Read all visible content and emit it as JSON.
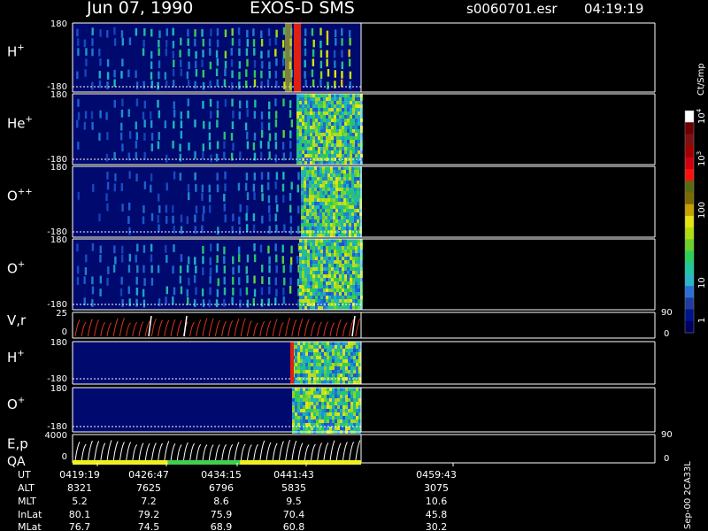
{
  "header": {
    "date": "Jun 07, 1990",
    "instrument": "EXOS-D SMS",
    "file": "s0060701.esr",
    "time": "04:19:19"
  },
  "colorbar": {
    "unit": "Ct/Smp",
    "tick_labels": [
      "1",
      "10",
      "100",
      "10",
      "10"
    ],
    "exponents": [
      "3",
      "4"
    ],
    "colors": [
      "#000060",
      "#00148c",
      "#1f3ca0",
      "#2c6ed8",
      "#29b7c8",
      "#20c8a0",
      "#2bd05a",
      "#6cd02a",
      "#b0dc10",
      "#e4e410",
      "#c8a000",
      "#7a6a00",
      "#5a6a10",
      "#ff1010",
      "#d00010",
      "#a00000",
      "#801010",
      "#6a0000",
      "#ffffff"
    ]
  },
  "panels": [
    {
      "id": "h-plus",
      "label": "H",
      "sup": "+",
      "ymax": "180",
      "ymin": "-180"
    },
    {
      "id": "he-plus",
      "label": "He",
      "sup": "+",
      "ymax": "180",
      "ymin": "-180"
    },
    {
      "id": "o-plusplus",
      "label": "O",
      "sup": "++",
      "ymax": "180",
      "ymin": "-180"
    },
    {
      "id": "o-plus",
      "label": "O",
      "sup": "+",
      "ymax": "180",
      "ymin": "-180"
    },
    {
      "id": "vr",
      "label": "V,r",
      "sup": "",
      "ymax": "25",
      "ymin": "0",
      "r_max": "90",
      "r_min": "0"
    },
    {
      "id": "h-plus-2",
      "label": "H",
      "sup": "+",
      "ymax": "180",
      "ymin": "-180"
    },
    {
      "id": "o-plus-2",
      "label": "O",
      "sup": "+",
      "ymax": "180",
      "ymin": "-180"
    },
    {
      "id": "ep-qa",
      "label": "E,p",
      "label2": "QA",
      "sup": "",
      "ymax": "4000",
      "ymin": "0",
      "r_max": "90",
      "r_min": "0"
    }
  ],
  "chart_data": {
    "type": "heatmap",
    "title": "Jun 07, 1990   EXOS-D SMS",
    "xlabel": "UT",
    "colorbar_label": "Ct/Smp",
    "colorbar_ticks": [
      "1",
      "10",
      "100",
      "10^3",
      "10^4"
    ],
    "ephemeris": {
      "rows": [
        "UT",
        "ALT",
        "MLT",
        "InLat",
        "MLat"
      ],
      "columns": [
        {
          "UT": "0419:19",
          "ALT": "8321",
          "MLT": "5.2",
          "InLat": "80.1",
          "MLat": "76.7"
        },
        {
          "UT": "0426:47",
          "ALT": "7625",
          "MLT": "7.2",
          "InLat": "79.2",
          "MLat": "74.5"
        },
        {
          "UT": "0434:15",
          "ALT": "6796",
          "MLT": "8.6",
          "InLat": "75.9",
          "MLat": "68.9"
        },
        {
          "UT": "0441:43",
          "ALT": "5835",
          "MLT": "9.5",
          "InLat": "70.4",
          "MLat": "60.8"
        },
        {
          "UT": "0459:43",
          "ALT": "3075",
          "MLT": "10.6",
          "InLat": "45.8",
          "MLat": "30.2"
        }
      ]
    },
    "qa_bar": [
      {
        "color": "yellow",
        "fraction": 0.33
      },
      {
        "color": "green",
        "fraction": 0.25
      },
      {
        "color": "yellow",
        "fraction": 0.42
      }
    ]
  },
  "side_text": "Sep-00  2CA33L"
}
